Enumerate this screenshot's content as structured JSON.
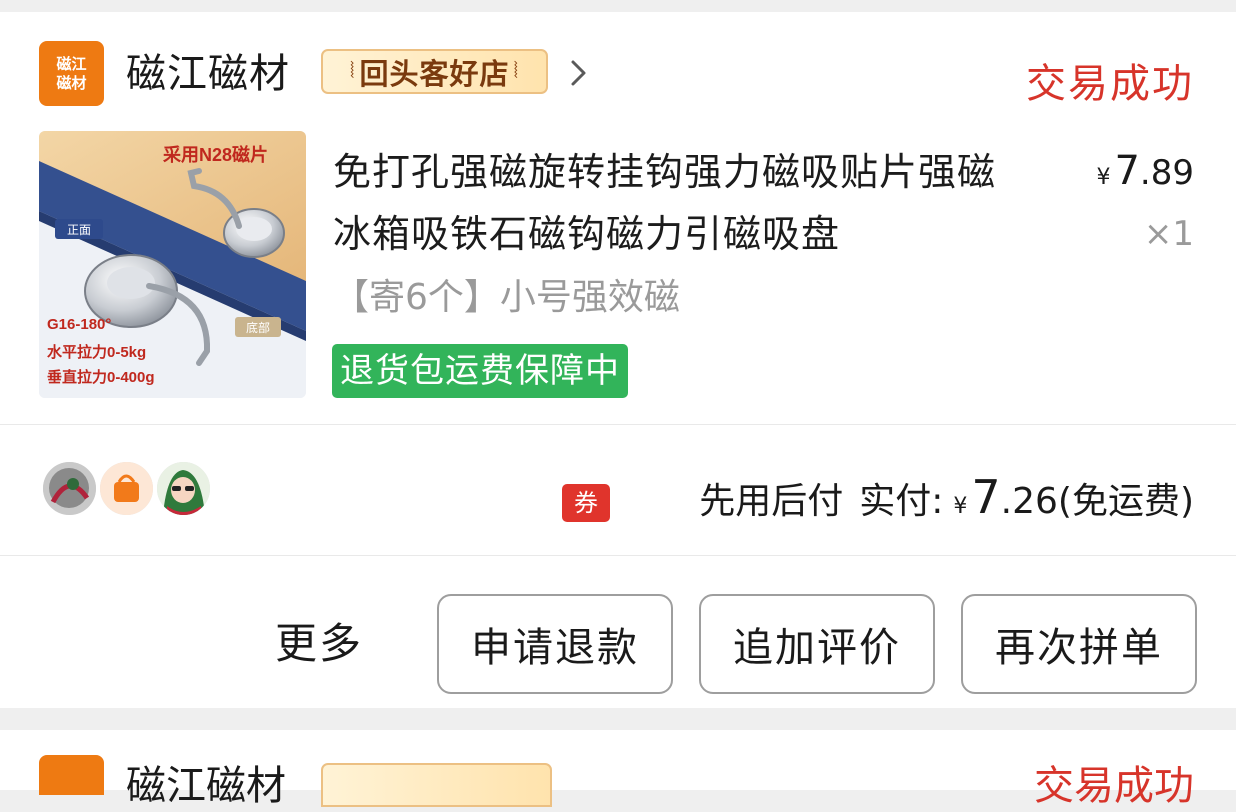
{
  "shop": {
    "logo_line1": "磁江",
    "logo_line2": "磁材",
    "name": "磁江磁材",
    "badge": "回头客好店"
  },
  "order": {
    "status": "交易成功"
  },
  "product": {
    "title": "免打孔强磁旋转挂钩强力磁吸贴片强磁冰箱吸铁石磁钩磁力引磁吸盘",
    "sku": "【寄6个】小号强效磁",
    "guarantee": "退货包运费保障中",
    "price_symbol": "¥",
    "price_int": "7",
    "price_dec": ".89",
    "quantity": "×1",
    "image": {
      "banner": "采用N28磁片",
      "tag_front": "正面",
      "tag_bottom": "底部",
      "spec1": "G16-180°",
      "spec2": "水平拉力0-5kg",
      "spec3": "垂直拉力0-400g"
    }
  },
  "payment": {
    "coupon": "券",
    "method": "先用后付",
    "label": "实付:",
    "symbol": "¥",
    "amount_int": "7",
    "amount_dec": ".26",
    "shipping": "(免运费)"
  },
  "actions": {
    "more": "更多",
    "refund": "申请退款",
    "review": "追加评价",
    "reorder": "再次拼单"
  },
  "next_card": {
    "name": "磁江磁材",
    "status": "交易成功"
  },
  "colors": {
    "status_red": "#d7342a",
    "logo_orange": "#ee7a12",
    "guarantee_green": "#32b45a",
    "coupon_red": "#e0342c"
  },
  "icons": {
    "chevron": "chevron-right-icon"
  }
}
